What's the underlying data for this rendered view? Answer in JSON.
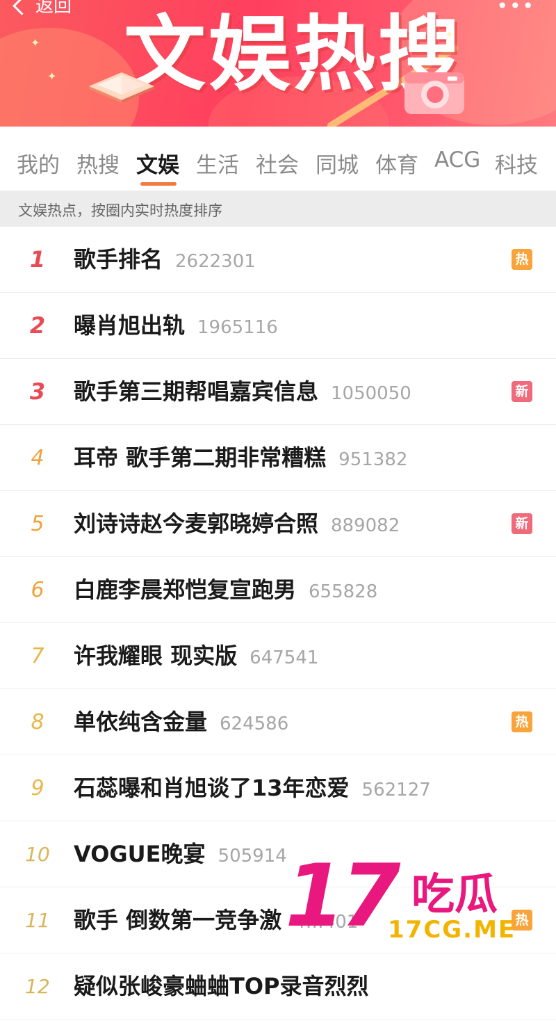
{
  "header": {
    "back_label": "返回",
    "title": "文娱热搜",
    "more_icon": "more-icon"
  },
  "tabs": [
    {
      "label": "我的",
      "active": false
    },
    {
      "label": "热搜",
      "active": false
    },
    {
      "label": "文娱",
      "active": true
    },
    {
      "label": "生活",
      "active": false
    },
    {
      "label": "社会",
      "active": false
    },
    {
      "label": "同城",
      "active": false
    },
    {
      "label": "体育",
      "active": false
    },
    {
      "label": "ACG",
      "active": false
    },
    {
      "label": "科技",
      "active": false
    }
  ],
  "subheader": "文娱热点，按圈内实时热度排序",
  "items": [
    {
      "rank": "1",
      "title": "歌手排名",
      "count": "2622301",
      "badge": "热"
    },
    {
      "rank": "2",
      "title": "曝肖旭出轨",
      "count": "1965116",
      "badge": ""
    },
    {
      "rank": "3",
      "title": "歌手第三期帮唱嘉宾信息",
      "count": "1050050",
      "badge": "新"
    },
    {
      "rank": "4",
      "title": "耳帝 歌手第二期非常糟糕",
      "count": "951382",
      "badge": ""
    },
    {
      "rank": "5",
      "title": "刘诗诗赵今麦郭晓婷合照",
      "count": "889082",
      "badge": "新"
    },
    {
      "rank": "6",
      "title": "白鹿李晨郑恺复宣跑男",
      "count": "655828",
      "badge": ""
    },
    {
      "rank": "7",
      "title": "许我耀眼 现实版",
      "count": "647541",
      "badge": ""
    },
    {
      "rank": "8",
      "title": "单依纯含金量",
      "count": "624586",
      "badge": "热"
    },
    {
      "rank": "9",
      "title": "石蕊曝和肖旭谈了13年恋爱",
      "count": "562127",
      "badge": ""
    },
    {
      "rank": "10",
      "title": "VOGUE晚宴",
      "count": "505914",
      "badge": ""
    },
    {
      "rank": "11",
      "title": "歌手 倒数第一竞争激",
      "count": "4…401",
      "badge": "热"
    },
    {
      "rank": "12",
      "title": "疑似张峻豪蛐蛐TOP录音烈烈",
      "count": "",
      "badge": ""
    }
  ],
  "watermark": {
    "big": "17",
    "brand": "吃瓜",
    "url": "17CG.ME",
    "color": "#e8187e",
    "url_color": "#f2b400"
  },
  "colors": {
    "banner": "#ff3f5e",
    "tab_active_underline": "#f07a3c",
    "rank_top": "#e94b55",
    "rank_other": "#f0a23a",
    "badge_hot": "#f8a43a",
    "badge_new": "#ef6a7a"
  }
}
